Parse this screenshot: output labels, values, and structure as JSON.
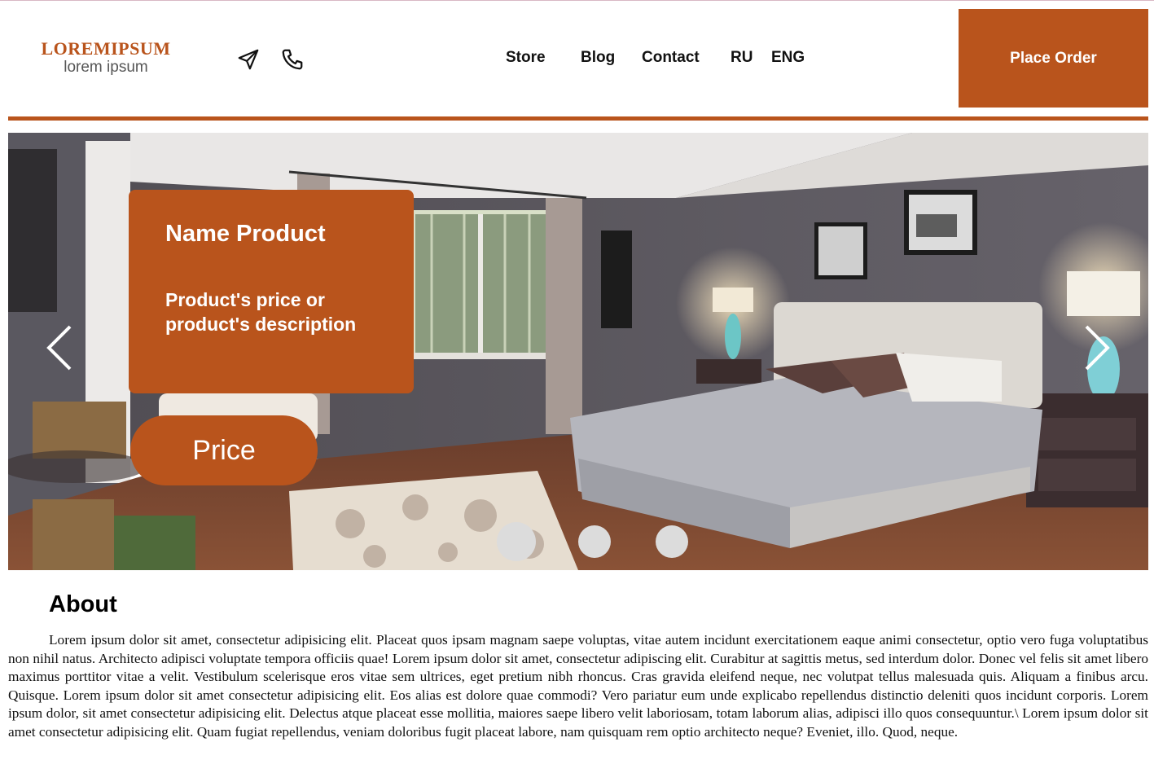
{
  "header": {
    "logo_title": "LOREMIPSUM",
    "logo_subtitle": "lorem ipsum",
    "icons": [
      "send-icon",
      "phone-icon"
    ],
    "nav": {
      "store": "Store",
      "blog": "Blog",
      "contact": "Contact",
      "lang_ru": "RU",
      "lang_eng": "ENG"
    },
    "order_button": "Place Order"
  },
  "slider": {
    "product_name": "Name Product",
    "product_description": "Product's price or product's description",
    "price_button": "Price",
    "prev_icon": "chevron-left-icon",
    "next_icon": "chevron-right-icon",
    "dots_count": 3,
    "active_dot": 1
  },
  "about": {
    "title": "About",
    "text": "Lorem ipsum dolor sit amet, consectetur adipisicing elit. Placeat quos ipsam magnam saepe voluptas, vitae autem incidunt exercitationem eaque animi consectetur, optio vero fuga voluptatibus non nihil natus. Architecto adipisci voluptate tempora officiis quae! Lorem ipsum dolor sit amet, consectetur adipiscing elit. Curabitur at sagittis metus, sed interdum dolor. Donec vel felis sit amet libero maximus porttitor vitae a velit. Vestibulum scelerisque eros vitae sem ultrices, eget pretium nibh rhoncus. Cras gravida eleifend neque, nec volutpat tellus malesuada quis. Aliquam a finibus arcu. Quisque. Lorem ipsum dolor sit amet consectetur adipisicing elit. Eos alias est dolore quae commodi? Vero pariatur eum unde explicabo repellendus distinctio deleniti quos incidunt corporis. Lorem ipsum dolor, sit amet consectetur adipisicing elit. Delectus atque placeat esse mollitia, maiores saepe libero velit laboriosam, totam laborum alias, adipisci illo quos consequuntur.\\ Lorem ipsum dolor sit amet consectetur adipisicing elit. Quam fugiat repellendus, veniam doloribus fugit placeat labore, nam quisquam rem optio architecto neque? Eveniet, illo. Quod, neque."
  },
  "colors": {
    "accent": "#b9541c",
    "text": "#111111",
    "background": "#ffffff"
  }
}
